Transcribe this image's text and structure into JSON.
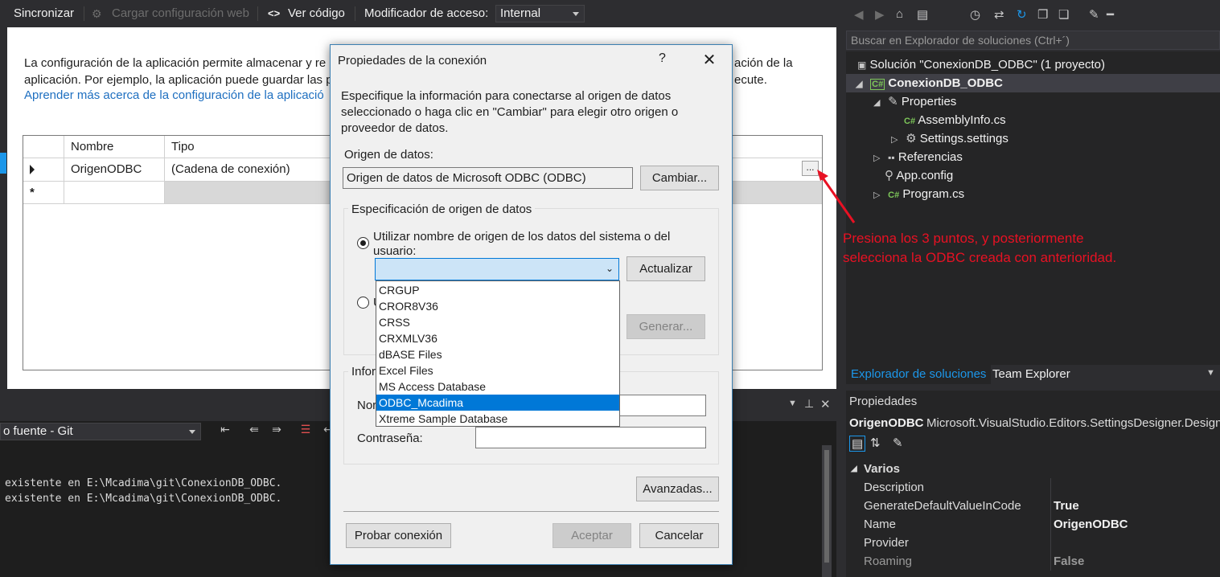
{
  "toolbar": {
    "sync": "Sincronizar",
    "load_web": "Cargar configuración web",
    "view_code": "Ver código",
    "view_code_icon": "<>",
    "access_label": "Modificador de acceso:",
    "access_value": "Internal"
  },
  "editor": {
    "desc_line1": "La configuración de la aplicación permite almacenar y re",
    "desc_line1_tail": "ación de la",
    "desc_line2": "aplicación. Por ejemplo, la aplicación puede guardar las p",
    "desc_line2_tail": "ecute.",
    "learn_more": "Aprender más acerca de la configuración de la aplicació",
    "grid": {
      "headers": [
        "Nombre",
        "Tipo"
      ],
      "rows": [
        {
          "name": "OrigenODBC",
          "type": "(Cadena de conexión)"
        }
      ],
      "new_row_marker": "*",
      "ellipsis": "..."
    }
  },
  "output": {
    "source_select": "o fuente - Git",
    "lines": [
      "existente en E:\\Mcadima\\git\\ConexionDB_ODBC.",
      "existente en E:\\Mcadima\\git\\ConexionDB_ODBC."
    ]
  },
  "dialog": {
    "title": "Propiedades de la conexión",
    "help": "?",
    "close": "✕",
    "intro_line1": "Especifique la información para conectarse al origen de datos",
    "intro_line2": "seleccionado o haga clic en \"Cambiar\" para elegir otro origen o",
    "intro_line3": "proveedor de datos.",
    "datasource_label": "Origen de datos:",
    "datasource_value": "Origen de datos de Microsoft ODBC (ODBC)",
    "change_button": "Cambiar...",
    "spec_group": "Especificación de origen de datos",
    "radio_dsn_line1": "Utilizar nombre de origen de los datos del sistema o del",
    "radio_dsn_line2": "usuario:",
    "refresh_button": "Actualizar",
    "radio_conn_fragment": "U",
    "build_button": "Generar...",
    "login_group": "Infor",
    "user_label_fragment": "Nor",
    "password_label": "Contraseña:",
    "advanced_button": "Avanzadas...",
    "test_button": "Probar conexión",
    "accept_button": "Aceptar",
    "cancel_button": "Cancelar",
    "dsn_options": [
      "CRGUP",
      "CROR8V36",
      "CRSS",
      "CRXMLV36",
      "dBASE Files",
      "Excel Files",
      "MS Access Database",
      "ODBC_Mcadima",
      "Xtreme Sample Database"
    ],
    "dsn_highlighted": "ODBC_Mcadima"
  },
  "annotation": {
    "line1": "Presiona los 3 puntos, y posteriormente",
    "line2": "selecciona la ODBC creada con anterioridad.",
    "color": "#e81123"
  },
  "solution_explorer": {
    "search_placeholder": "Buscar en Explorador de soluciones (Ctrl+´)",
    "tree": {
      "solution": "Solución \"ConexionDB_ODBC\"  (1 proyecto)",
      "project": "ConexionDB_ODBC",
      "properties": "Properties",
      "assemblyinfo": "AssemblyInfo.cs",
      "settings": "Settings.settings",
      "references": "Referencias",
      "appconfig": "App.config",
      "program": "Program.cs"
    },
    "tabs": [
      "Explorador de soluciones",
      "Team Explorer"
    ]
  },
  "properties": {
    "title": "Propiedades",
    "object_name": "OrigenODBC",
    "object_type": "Microsoft.VisualStudio.Editors.SettingsDesigner.DesignT",
    "category": "Varios",
    "rows": [
      {
        "name": "Description",
        "value": ""
      },
      {
        "name": "GenerateDefaultValueInCode",
        "value": "True"
      },
      {
        "name": "Name",
        "value": "OrigenODBC"
      },
      {
        "name": "Provider",
        "value": ""
      },
      {
        "name": "Roaming",
        "value": "False"
      }
    ]
  },
  "colors": {
    "accent": "#0078d7",
    "link": "#1e6fc0",
    "vs_dark": "#2d2d30"
  }
}
